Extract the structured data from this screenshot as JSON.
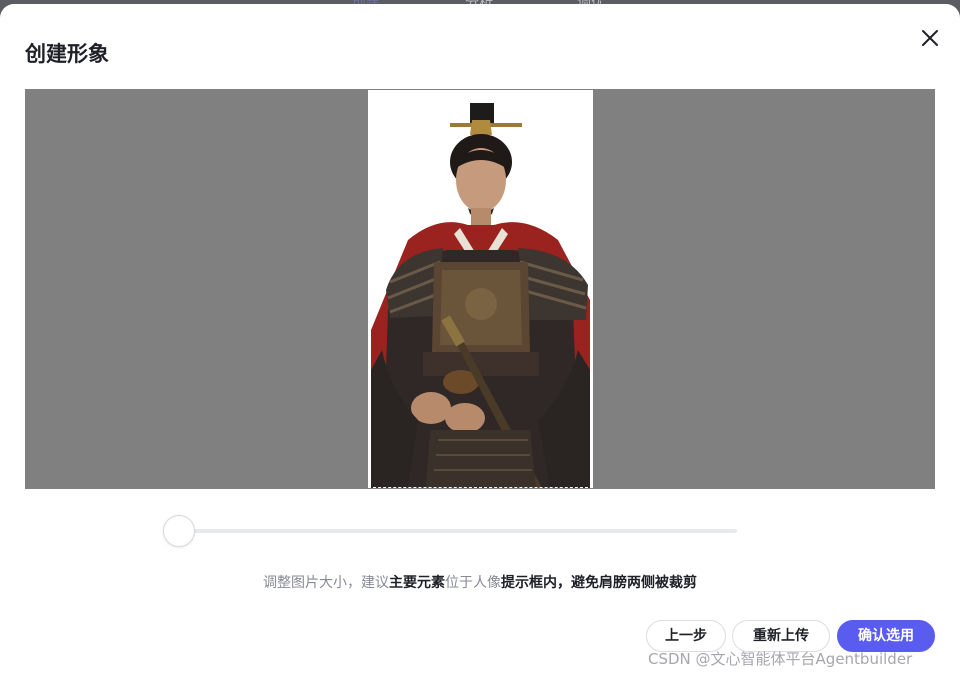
{
  "background_tabs": [
    "创建",
    "分析",
    "调优"
  ],
  "modal": {
    "title": "创建形象",
    "close_icon": "close-icon"
  },
  "slider": {
    "zoom_fraction": 0
  },
  "hint": {
    "part1": "调整图片大小，建议",
    "part2": "主要元素",
    "part3": "位于人像",
    "part4": "提示框内，避免肩膀两侧被裁剪"
  },
  "buttons": {
    "prev": "上一步",
    "reupload": "重新上传",
    "confirm": "确认选用"
  },
  "watermark": "CSDN @文心智能体平台Agentbuilder",
  "colors": {
    "accent": "#5a5cf0",
    "crop_backdrop": "#808080"
  }
}
